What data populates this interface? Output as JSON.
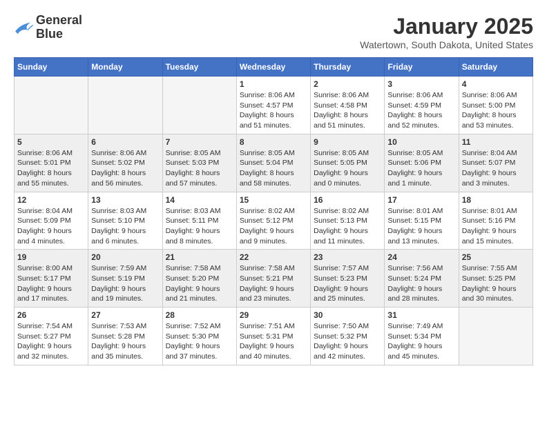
{
  "header": {
    "logo_line1": "General",
    "logo_line2": "Blue",
    "month_year": "January 2025",
    "location": "Watertown, South Dakota, United States"
  },
  "days_of_week": [
    "Sunday",
    "Monday",
    "Tuesday",
    "Wednesday",
    "Thursday",
    "Friday",
    "Saturday"
  ],
  "weeks": [
    {
      "row_bg": "light",
      "days": [
        {
          "date": "",
          "info": ""
        },
        {
          "date": "",
          "info": ""
        },
        {
          "date": "",
          "info": ""
        },
        {
          "date": "1",
          "info": "Sunrise: 8:06 AM\nSunset: 4:57 PM\nDaylight: 8 hours\nand 51 minutes."
        },
        {
          "date": "2",
          "info": "Sunrise: 8:06 AM\nSunset: 4:58 PM\nDaylight: 8 hours\nand 51 minutes."
        },
        {
          "date": "3",
          "info": "Sunrise: 8:06 AM\nSunset: 4:59 PM\nDaylight: 8 hours\nand 52 minutes."
        },
        {
          "date": "4",
          "info": "Sunrise: 8:06 AM\nSunset: 5:00 PM\nDaylight: 8 hours\nand 53 minutes."
        }
      ]
    },
    {
      "row_bg": "dark",
      "days": [
        {
          "date": "5",
          "info": "Sunrise: 8:06 AM\nSunset: 5:01 PM\nDaylight: 8 hours\nand 55 minutes."
        },
        {
          "date": "6",
          "info": "Sunrise: 8:06 AM\nSunset: 5:02 PM\nDaylight: 8 hours\nand 56 minutes."
        },
        {
          "date": "7",
          "info": "Sunrise: 8:05 AM\nSunset: 5:03 PM\nDaylight: 8 hours\nand 57 minutes."
        },
        {
          "date": "8",
          "info": "Sunrise: 8:05 AM\nSunset: 5:04 PM\nDaylight: 8 hours\nand 58 minutes."
        },
        {
          "date": "9",
          "info": "Sunrise: 8:05 AM\nSunset: 5:05 PM\nDaylight: 9 hours\nand 0 minutes."
        },
        {
          "date": "10",
          "info": "Sunrise: 8:05 AM\nSunset: 5:06 PM\nDaylight: 9 hours\nand 1 minute."
        },
        {
          "date": "11",
          "info": "Sunrise: 8:04 AM\nSunset: 5:07 PM\nDaylight: 9 hours\nand 3 minutes."
        }
      ]
    },
    {
      "row_bg": "light",
      "days": [
        {
          "date": "12",
          "info": "Sunrise: 8:04 AM\nSunset: 5:09 PM\nDaylight: 9 hours\nand 4 minutes."
        },
        {
          "date": "13",
          "info": "Sunrise: 8:03 AM\nSunset: 5:10 PM\nDaylight: 9 hours\nand 6 minutes."
        },
        {
          "date": "14",
          "info": "Sunrise: 8:03 AM\nSunset: 5:11 PM\nDaylight: 9 hours\nand 8 minutes."
        },
        {
          "date": "15",
          "info": "Sunrise: 8:02 AM\nSunset: 5:12 PM\nDaylight: 9 hours\nand 9 minutes."
        },
        {
          "date": "16",
          "info": "Sunrise: 8:02 AM\nSunset: 5:13 PM\nDaylight: 9 hours\nand 11 minutes."
        },
        {
          "date": "17",
          "info": "Sunrise: 8:01 AM\nSunset: 5:15 PM\nDaylight: 9 hours\nand 13 minutes."
        },
        {
          "date": "18",
          "info": "Sunrise: 8:01 AM\nSunset: 5:16 PM\nDaylight: 9 hours\nand 15 minutes."
        }
      ]
    },
    {
      "row_bg": "dark",
      "days": [
        {
          "date": "19",
          "info": "Sunrise: 8:00 AM\nSunset: 5:17 PM\nDaylight: 9 hours\nand 17 minutes."
        },
        {
          "date": "20",
          "info": "Sunrise: 7:59 AM\nSunset: 5:19 PM\nDaylight: 9 hours\nand 19 minutes."
        },
        {
          "date": "21",
          "info": "Sunrise: 7:58 AM\nSunset: 5:20 PM\nDaylight: 9 hours\nand 21 minutes."
        },
        {
          "date": "22",
          "info": "Sunrise: 7:58 AM\nSunset: 5:21 PM\nDaylight: 9 hours\nand 23 minutes."
        },
        {
          "date": "23",
          "info": "Sunrise: 7:57 AM\nSunset: 5:23 PM\nDaylight: 9 hours\nand 25 minutes."
        },
        {
          "date": "24",
          "info": "Sunrise: 7:56 AM\nSunset: 5:24 PM\nDaylight: 9 hours\nand 28 minutes."
        },
        {
          "date": "25",
          "info": "Sunrise: 7:55 AM\nSunset: 5:25 PM\nDaylight: 9 hours\nand 30 minutes."
        }
      ]
    },
    {
      "row_bg": "light",
      "days": [
        {
          "date": "26",
          "info": "Sunrise: 7:54 AM\nSunset: 5:27 PM\nDaylight: 9 hours\nand 32 minutes."
        },
        {
          "date": "27",
          "info": "Sunrise: 7:53 AM\nSunset: 5:28 PM\nDaylight: 9 hours\nand 35 minutes."
        },
        {
          "date": "28",
          "info": "Sunrise: 7:52 AM\nSunset: 5:30 PM\nDaylight: 9 hours\nand 37 minutes."
        },
        {
          "date": "29",
          "info": "Sunrise: 7:51 AM\nSunset: 5:31 PM\nDaylight: 9 hours\nand 40 minutes."
        },
        {
          "date": "30",
          "info": "Sunrise: 7:50 AM\nSunset: 5:32 PM\nDaylight: 9 hours\nand 42 minutes."
        },
        {
          "date": "31",
          "info": "Sunrise: 7:49 AM\nSunset: 5:34 PM\nDaylight: 9 hours\nand 45 minutes."
        },
        {
          "date": "",
          "info": ""
        }
      ]
    }
  ]
}
